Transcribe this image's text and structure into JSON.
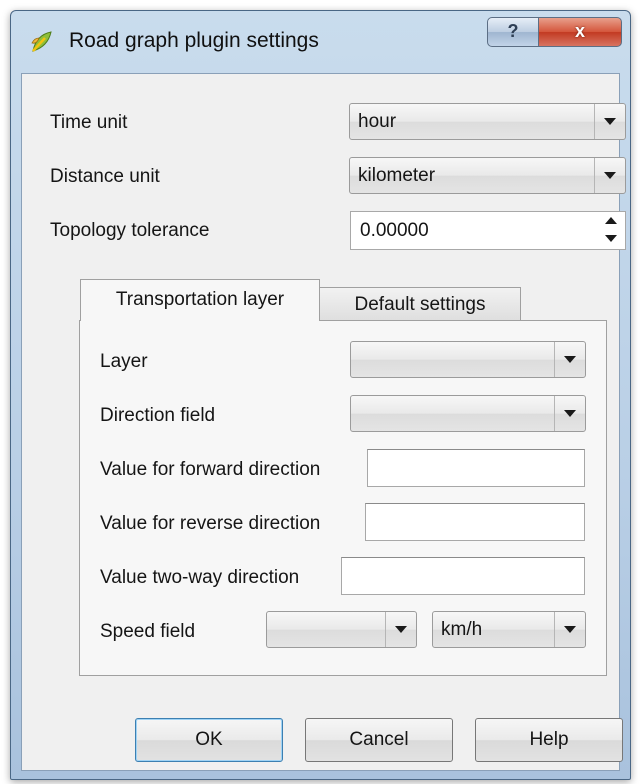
{
  "window": {
    "title": "Road graph plugin settings",
    "help_glyph": "?",
    "close_glyph": "x"
  },
  "general": {
    "time_unit_label": "Time unit",
    "time_unit_value": "hour",
    "distance_unit_label": "Distance unit",
    "distance_unit_value": "kilometer",
    "topology_tolerance_label": "Topology tolerance",
    "topology_tolerance_value": "0.00000"
  },
  "tabs": [
    {
      "label": "Transportation layer",
      "active": true
    },
    {
      "label": "Default settings",
      "active": false
    }
  ],
  "transport": {
    "layer_label": "Layer",
    "layer_value": "",
    "direction_field_label": "Direction field",
    "direction_field_value": "",
    "forward_label": "Value for forward direction",
    "forward_value": "",
    "reverse_label": "Value for reverse direction",
    "reverse_value": "",
    "twoway_label": "Value two-way direction",
    "twoway_value": "",
    "speed_field_label": "Speed field",
    "speed_field_value": "",
    "speed_unit_value": "km/h"
  },
  "buttons": {
    "ok": "OK",
    "cancel": "Cancel",
    "help": "Help"
  },
  "icons": {
    "app": "qgis-leaf-icon",
    "combo_arrow": "chevron-down-icon"
  },
  "colors": {
    "frame": "#b9cfe6",
    "close": "#c23a22",
    "dialog_bg": "#f0f0f0"
  }
}
